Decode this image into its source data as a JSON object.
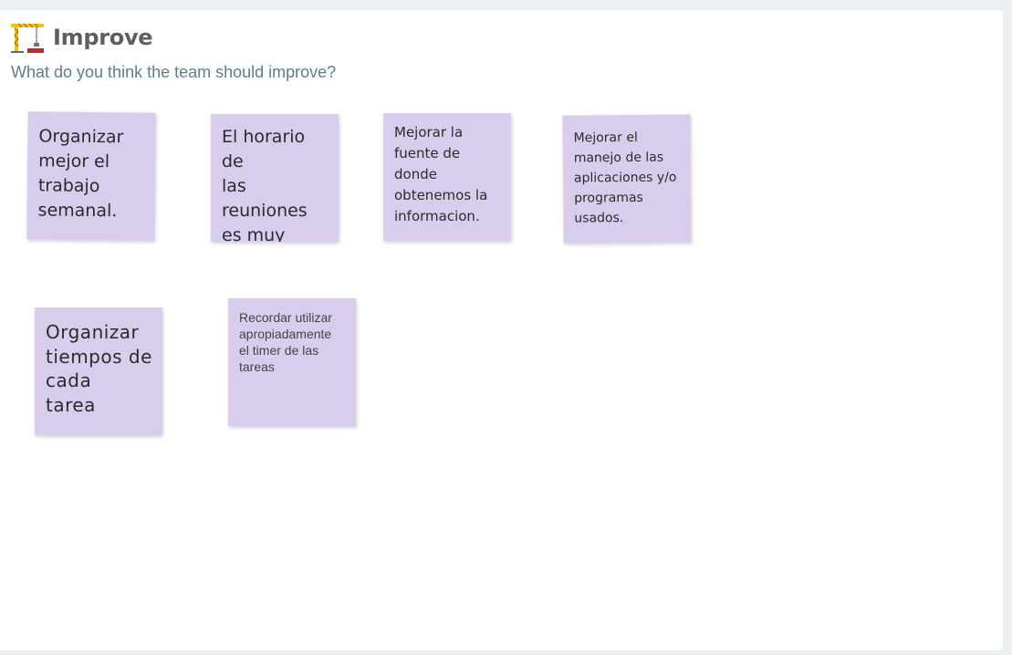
{
  "section": {
    "icon": "construction-crane-icon",
    "title": "Improve",
    "subtitle": "What do you think the team should improve?"
  },
  "colors": {
    "note_background": "#d9cdee",
    "page_background": "#eceff1",
    "title_color": "#5f5f5f",
    "subtitle_color": "#607d8b"
  },
  "notes": [
    {
      "text": "Organizar\nmejor el\ntrabajo\nsemanal."
    },
    {
      "text": "El horario de\nlas reuniones\nes muy tarde"
    },
    {
      "text": "Mejorar la\nfuente de donde\nobtenemos la\ninformacion."
    },
    {
      "text": "Mejorar el\nmanejo de las\naplicaciones y/o\nprogramas\nusados."
    },
    {
      "text": "Organizar\ntiempos de\ncada\ntarea"
    },
    {
      "text": "Recordar utilizar\napropiadamente\nel timer de las\ntareas"
    }
  ]
}
